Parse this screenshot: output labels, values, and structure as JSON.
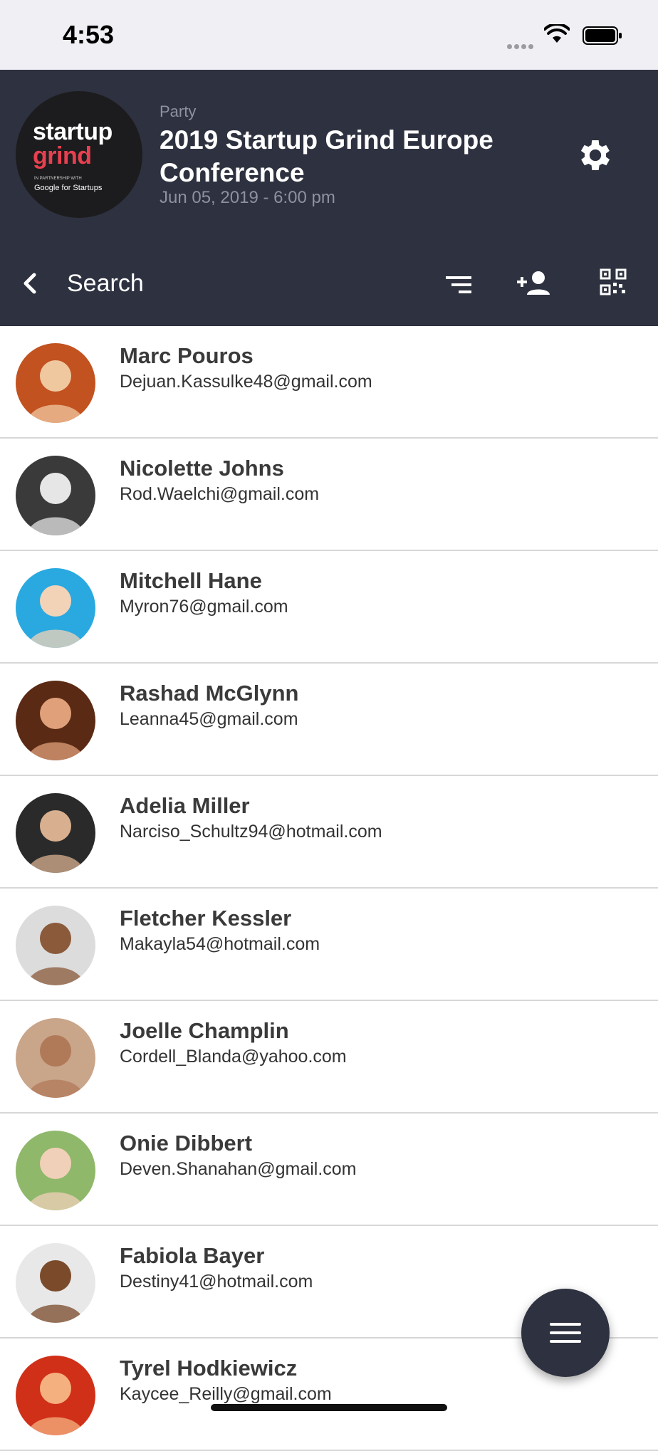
{
  "status_bar": {
    "time": "4:53"
  },
  "event": {
    "logo": {
      "line1": "startup",
      "line2": "grind",
      "partner_text": "IN PARTNERSHIP WITH",
      "google_text": "Google for Startups"
    },
    "category": "Party",
    "title": "2019 Startup Grind Europe Conference",
    "date": "Jun 05, 2019 - 6:00 pm"
  },
  "toolbar": {
    "search_placeholder": "Search",
    "icons": [
      "back-chevron-icon",
      "filter-icon",
      "add-person-icon",
      "qr-code-icon"
    ]
  },
  "attendees": [
    {
      "name": "Marc Pouros",
      "email": "Dejuan.Kassulke48@gmail.com",
      "avatar_bg": "#c2521f",
      "avatar_fg": "#f0c8a0"
    },
    {
      "name": "Nicolette Johns",
      "email": "Rod.Waelchi@gmail.com",
      "avatar_bg": "#3a3a3a",
      "avatar_fg": "#e6e6e6"
    },
    {
      "name": "Mitchell Hane",
      "email": "Myron76@gmail.com",
      "avatar_bg": "#29a9e0",
      "avatar_fg": "#f3d3b8"
    },
    {
      "name": "Rashad McGlynn",
      "email": "Leanna45@gmail.com",
      "avatar_bg": "#5a2a14",
      "avatar_fg": "#e0a07a"
    },
    {
      "name": "Adelia Miller",
      "email": "Narciso_Schultz94@hotmail.com",
      "avatar_bg": "#2a2a2a",
      "avatar_fg": "#d8b090"
    },
    {
      "name": "Fletcher Kessler",
      "email": "Makayla54@hotmail.com",
      "avatar_bg": "#dcdcdc",
      "avatar_fg": "#8a5a3a"
    },
    {
      "name": "Joelle Champlin",
      "email": "Cordell_Blanda@yahoo.com",
      "avatar_bg": "#c9a58a",
      "avatar_fg": "#b07a58"
    },
    {
      "name": "Onie Dibbert",
      "email": "Deven.Shanahan@gmail.com",
      "avatar_bg": "#8fb86a",
      "avatar_fg": "#f0d0b8"
    },
    {
      "name": "Fabiola Bayer",
      "email": "Destiny41@hotmail.com",
      "avatar_bg": "#e8e8e8",
      "avatar_fg": "#7a4a2a"
    },
    {
      "name": "Tyrel Hodkiewicz",
      "email": "Kaycee_Reilly@gmail.com",
      "avatar_bg": "#d03018",
      "avatar_fg": "#f5b080"
    }
  ],
  "fab": {
    "icon": "menu-icon"
  },
  "colors": {
    "header_bg": "#2e313f",
    "brand_red": "#e8404f"
  }
}
